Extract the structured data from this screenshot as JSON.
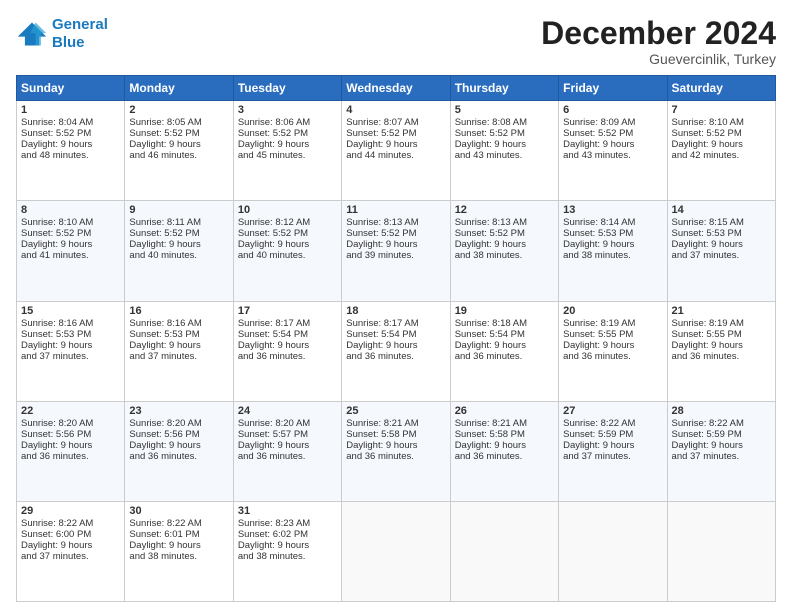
{
  "header": {
    "logo_line1": "General",
    "logo_line2": "Blue",
    "month": "December 2024",
    "location": "Guevercinlik, Turkey"
  },
  "weekdays": [
    "Sunday",
    "Monday",
    "Tuesday",
    "Wednesday",
    "Thursday",
    "Friday",
    "Saturday"
  ],
  "weeks": [
    [
      {
        "day": "1",
        "lines": [
          "Sunrise: 8:04 AM",
          "Sunset: 5:52 PM",
          "Daylight: 9 hours",
          "and 48 minutes."
        ]
      },
      {
        "day": "2",
        "lines": [
          "Sunrise: 8:05 AM",
          "Sunset: 5:52 PM",
          "Daylight: 9 hours",
          "and 46 minutes."
        ]
      },
      {
        "day": "3",
        "lines": [
          "Sunrise: 8:06 AM",
          "Sunset: 5:52 PM",
          "Daylight: 9 hours",
          "and 45 minutes."
        ]
      },
      {
        "day": "4",
        "lines": [
          "Sunrise: 8:07 AM",
          "Sunset: 5:52 PM",
          "Daylight: 9 hours",
          "and 44 minutes."
        ]
      },
      {
        "day": "5",
        "lines": [
          "Sunrise: 8:08 AM",
          "Sunset: 5:52 PM",
          "Daylight: 9 hours",
          "and 43 minutes."
        ]
      },
      {
        "day": "6",
        "lines": [
          "Sunrise: 8:09 AM",
          "Sunset: 5:52 PM",
          "Daylight: 9 hours",
          "and 43 minutes."
        ]
      },
      {
        "day": "7",
        "lines": [
          "Sunrise: 8:10 AM",
          "Sunset: 5:52 PM",
          "Daylight: 9 hours",
          "and 42 minutes."
        ]
      }
    ],
    [
      {
        "day": "8",
        "lines": [
          "Sunrise: 8:10 AM",
          "Sunset: 5:52 PM",
          "Daylight: 9 hours",
          "and 41 minutes."
        ]
      },
      {
        "day": "9",
        "lines": [
          "Sunrise: 8:11 AM",
          "Sunset: 5:52 PM",
          "Daylight: 9 hours",
          "and 40 minutes."
        ]
      },
      {
        "day": "10",
        "lines": [
          "Sunrise: 8:12 AM",
          "Sunset: 5:52 PM",
          "Daylight: 9 hours",
          "and 40 minutes."
        ]
      },
      {
        "day": "11",
        "lines": [
          "Sunrise: 8:13 AM",
          "Sunset: 5:52 PM",
          "Daylight: 9 hours",
          "and 39 minutes."
        ]
      },
      {
        "day": "12",
        "lines": [
          "Sunrise: 8:13 AM",
          "Sunset: 5:52 PM",
          "Daylight: 9 hours",
          "and 38 minutes."
        ]
      },
      {
        "day": "13",
        "lines": [
          "Sunrise: 8:14 AM",
          "Sunset: 5:53 PM",
          "Daylight: 9 hours",
          "and 38 minutes."
        ]
      },
      {
        "day": "14",
        "lines": [
          "Sunrise: 8:15 AM",
          "Sunset: 5:53 PM",
          "Daylight: 9 hours",
          "and 37 minutes."
        ]
      }
    ],
    [
      {
        "day": "15",
        "lines": [
          "Sunrise: 8:16 AM",
          "Sunset: 5:53 PM",
          "Daylight: 9 hours",
          "and 37 minutes."
        ]
      },
      {
        "day": "16",
        "lines": [
          "Sunrise: 8:16 AM",
          "Sunset: 5:53 PM",
          "Daylight: 9 hours",
          "and 37 minutes."
        ]
      },
      {
        "day": "17",
        "lines": [
          "Sunrise: 8:17 AM",
          "Sunset: 5:54 PM",
          "Daylight: 9 hours",
          "and 36 minutes."
        ]
      },
      {
        "day": "18",
        "lines": [
          "Sunrise: 8:17 AM",
          "Sunset: 5:54 PM",
          "Daylight: 9 hours",
          "and 36 minutes."
        ]
      },
      {
        "day": "19",
        "lines": [
          "Sunrise: 8:18 AM",
          "Sunset: 5:54 PM",
          "Daylight: 9 hours",
          "and 36 minutes."
        ]
      },
      {
        "day": "20",
        "lines": [
          "Sunrise: 8:19 AM",
          "Sunset: 5:55 PM",
          "Daylight: 9 hours",
          "and 36 minutes."
        ]
      },
      {
        "day": "21",
        "lines": [
          "Sunrise: 8:19 AM",
          "Sunset: 5:55 PM",
          "Daylight: 9 hours",
          "and 36 minutes."
        ]
      }
    ],
    [
      {
        "day": "22",
        "lines": [
          "Sunrise: 8:20 AM",
          "Sunset: 5:56 PM",
          "Daylight: 9 hours",
          "and 36 minutes."
        ]
      },
      {
        "day": "23",
        "lines": [
          "Sunrise: 8:20 AM",
          "Sunset: 5:56 PM",
          "Daylight: 9 hours",
          "and 36 minutes."
        ]
      },
      {
        "day": "24",
        "lines": [
          "Sunrise: 8:20 AM",
          "Sunset: 5:57 PM",
          "Daylight: 9 hours",
          "and 36 minutes."
        ]
      },
      {
        "day": "25",
        "lines": [
          "Sunrise: 8:21 AM",
          "Sunset: 5:58 PM",
          "Daylight: 9 hours",
          "and 36 minutes."
        ]
      },
      {
        "day": "26",
        "lines": [
          "Sunrise: 8:21 AM",
          "Sunset: 5:58 PM",
          "Daylight: 9 hours",
          "and 36 minutes."
        ]
      },
      {
        "day": "27",
        "lines": [
          "Sunrise: 8:22 AM",
          "Sunset: 5:59 PM",
          "Daylight: 9 hours",
          "and 37 minutes."
        ]
      },
      {
        "day": "28",
        "lines": [
          "Sunrise: 8:22 AM",
          "Sunset: 5:59 PM",
          "Daylight: 9 hours",
          "and 37 minutes."
        ]
      }
    ],
    [
      {
        "day": "29",
        "lines": [
          "Sunrise: 8:22 AM",
          "Sunset: 6:00 PM",
          "Daylight: 9 hours",
          "and 37 minutes."
        ]
      },
      {
        "day": "30",
        "lines": [
          "Sunrise: 8:22 AM",
          "Sunset: 6:01 PM",
          "Daylight: 9 hours",
          "and 38 minutes."
        ]
      },
      {
        "day": "31",
        "lines": [
          "Sunrise: 8:23 AM",
          "Sunset: 6:02 PM",
          "Daylight: 9 hours",
          "and 38 minutes."
        ]
      },
      null,
      null,
      null,
      null
    ]
  ]
}
